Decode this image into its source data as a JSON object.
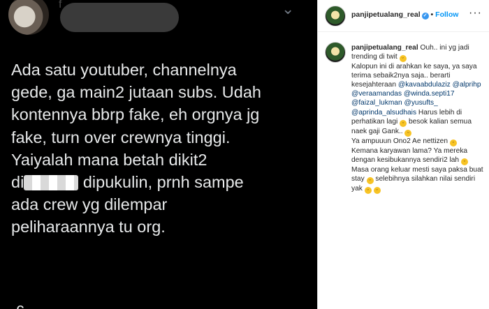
{
  "tweet": {
    "name_faint": "f",
    "lines": [
      "Ada satu youtuber, channelnya",
      "gede, ga main2 jutaan subs. Udah",
      "kontennya bbrp fake, eh orgnya jg",
      "fake, turn over crewnya tinggi.",
      "Yaiyalah mana betah dikit2"
    ],
    "line6_pre": "di",
    "line6_post": "dipukulin, prnh sampe",
    "line7": "ada  crew yg dilempar",
    "line8": "peliharaannya tu org.",
    "bottom": "-c-",
    "more_glyph": "⌄"
  },
  "instagram": {
    "username": "panjipetualang_real",
    "dot": "•",
    "follow": "Follow",
    "more_glyph": "···",
    "caption": {
      "t1": "Ouh.. ini yg jadi trending di twit",
      "t2": "Kalopun ini di arahkan ke saya, ya saya terima sebaik2nya saja.. berarti kesejahteraan",
      "m1": "@kavaabdulaziz",
      "m2": "@alprihp",
      "m3": "@veraamandas",
      "m4": "@winda.septi17",
      "m5": "@faizal_lukman",
      "m6": "@yusufts_",
      "m7": "@aprinda_alsudhais",
      "t3": "Harus lebih di perhatikan lagi",
      "t4": "besok kalian semua naek gaji Gank..",
      "t5": "Ya ampuuun Ono2 Ae nettizen",
      "t6": "Kemana karyawan lama? Ya mereka dengan kesibukannya sendiri2 lah",
      "t7": "Masa orang keluar mesti saya paksa buat stay",
      "t8": "selebihnya silahkan nilai sendiri yak"
    }
  }
}
